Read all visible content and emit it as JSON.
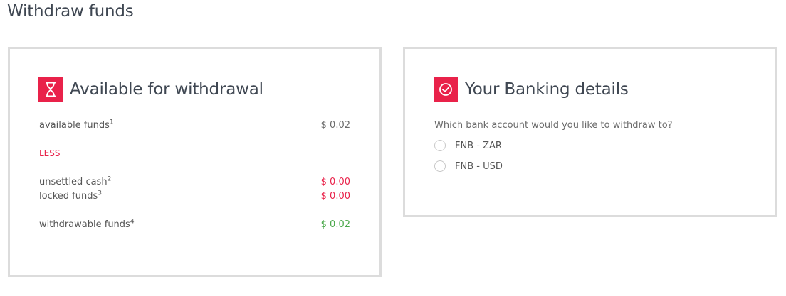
{
  "page": {
    "title": "Withdraw funds"
  },
  "available": {
    "title": "Available for withdrawal",
    "available_funds": {
      "label": "available funds",
      "note": "1",
      "value": "$ 0.02"
    },
    "less_label": "LESS",
    "unsettled_cash": {
      "label": "unsettled cash",
      "note": "2",
      "value": "$ 0.00"
    },
    "locked_funds": {
      "label": "locked funds",
      "note": "3",
      "value": "$ 0.00"
    },
    "withdrawable_funds": {
      "label": "withdrawable funds",
      "note": "4",
      "value": "$ 0.02"
    }
  },
  "banking": {
    "title": "Your Banking details",
    "question": "Which bank account would you like to withdraw to?",
    "accounts": [
      {
        "label": "FNB - ZAR",
        "selected": false
      },
      {
        "label": "FNB - USD",
        "selected": false
      }
    ]
  },
  "colors": {
    "accent": "#e9224a",
    "positive": "#4aa84a",
    "border": "#dcdcdc",
    "heading": "#3f4752"
  },
  "icons": {
    "available": "hourglass-icon",
    "banking": "check-circle-icon"
  }
}
